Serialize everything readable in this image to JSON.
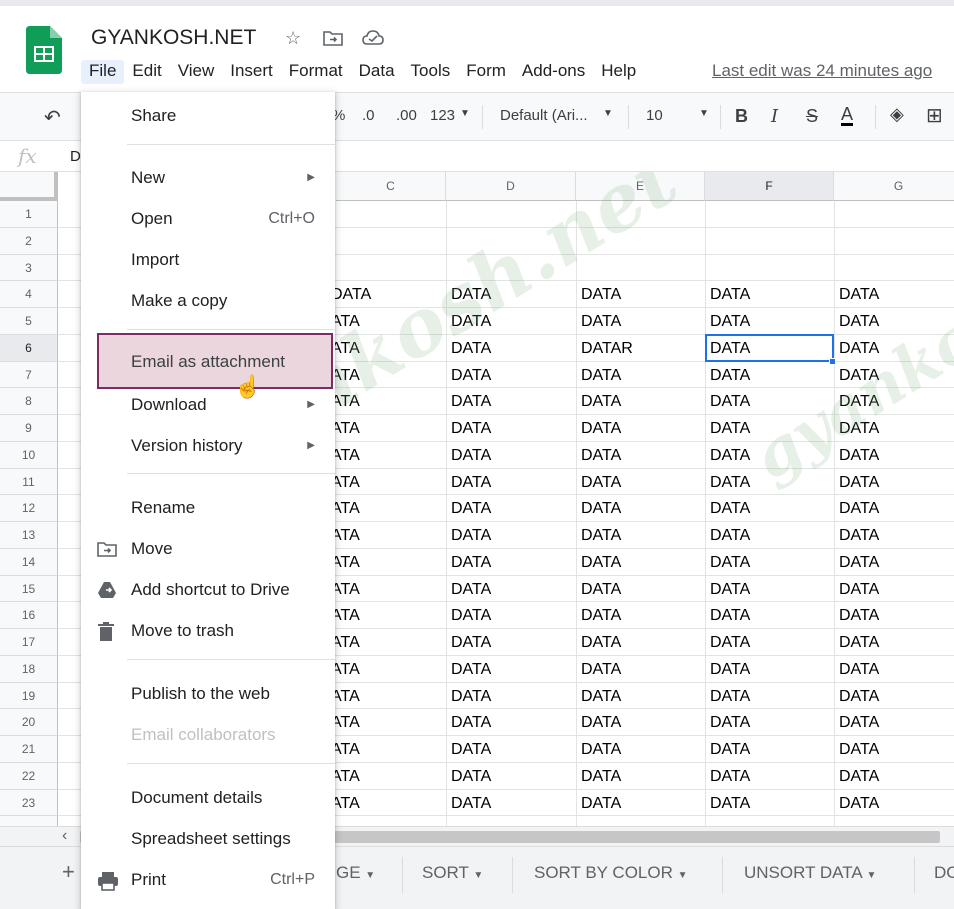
{
  "header": {
    "title": "GYANKOSH.NET",
    "last_edit": "Last edit was 24 minutes ago",
    "menus": [
      "File",
      "Edit",
      "View",
      "Insert",
      "Format",
      "Data",
      "Tools",
      "Form",
      "Add-ons",
      "Help"
    ]
  },
  "toolbar": {
    "percent": "%",
    "dec_less": ".0",
    "dec_more": ".00",
    "format_more": "123",
    "font": "Default (Ari...",
    "font_size": "10",
    "bold": "B",
    "italic": "I",
    "strike": "S",
    "text_color": "A"
  },
  "formula": {
    "fx": "fx",
    "value": "D"
  },
  "grid": {
    "columns": [
      "C",
      "D",
      "E",
      "F",
      "G"
    ],
    "selected_column": "F",
    "rows": [
      "1",
      "2",
      "3",
      "4",
      "5",
      "6",
      "7",
      "8",
      "9",
      "10",
      "11",
      "12",
      "13",
      "14",
      "15",
      "16",
      "17",
      "18",
      "19",
      "20",
      "21",
      "22",
      "23"
    ],
    "selected_row": "6",
    "cells": {
      "C": [
        "",
        "",
        "",
        "DATA",
        "ATA",
        "ATA",
        "ATA",
        "ATA",
        "ATA",
        "ATA",
        "ATA",
        "ATA",
        "ATA",
        "ATA",
        "ATA",
        "ATA",
        "ATA",
        "ATA",
        "ATA",
        "ATA",
        "ATA",
        "ATA",
        "ATA"
      ],
      "D": [
        "",
        "",
        "",
        "DATA",
        "DATA",
        "DATA",
        "DATA",
        "DATA",
        "DATA",
        "DATA",
        "DATA",
        "DATA",
        "DATA",
        "DATA",
        "DATA",
        "DATA",
        "DATA",
        "DATA",
        "DATA",
        "DATA",
        "DATA",
        "DATA",
        "DATA"
      ],
      "E": [
        "",
        "",
        "",
        "DATA",
        "DATA",
        "DATAR",
        "DATA",
        "DATA",
        "DATA",
        "DATA",
        "DATA",
        "DATA",
        "DATA",
        "DATA",
        "DATA",
        "DATA",
        "DATA",
        "DATA",
        "DATA",
        "DATA",
        "DATA",
        "DATA",
        "DATA"
      ],
      "F": [
        "",
        "",
        "",
        "DATA",
        "DATA",
        "DATA",
        "DATA",
        "DATA",
        "DATA",
        "DATA",
        "DATA",
        "DATA",
        "DATA",
        "DATA",
        "DATA",
        "DATA",
        "DATA",
        "DATA",
        "DATA",
        "DATA",
        "DATA",
        "DATA",
        "DATA"
      ],
      "G": [
        "",
        "",
        "",
        "DATA",
        "DATA",
        "DATA",
        "DATA",
        "DATA",
        "DATA",
        "DATA",
        "DATA",
        "DATA",
        "DATA",
        "DATA",
        "DATA",
        "DATA",
        "DATA",
        "DATA",
        "DATA",
        "DATA",
        "DATA",
        "DATA",
        "DATA"
      ]
    },
    "watermark": "gyankosh.net"
  },
  "sheets": [
    "GE",
    "SORT",
    "SORT BY COLOR",
    "UNSORT DATA",
    "DO"
  ],
  "file_menu": {
    "items": [
      {
        "label": "Share",
        "shortcut": "",
        "submenu": false,
        "disabled": false,
        "icon": "",
        "highlight": false
      },
      {
        "sep": true
      },
      {
        "label": "New",
        "shortcut": "",
        "submenu": true,
        "disabled": false,
        "icon": "",
        "highlight": false
      },
      {
        "label": "Open",
        "shortcut": "Ctrl+O",
        "submenu": false,
        "disabled": false,
        "icon": "",
        "highlight": false
      },
      {
        "label": "Import",
        "shortcut": "",
        "submenu": false,
        "disabled": false,
        "icon": "",
        "highlight": false
      },
      {
        "label": "Make a copy",
        "shortcut": "",
        "submenu": false,
        "disabled": false,
        "icon": "",
        "highlight": false
      },
      {
        "sep": true
      },
      {
        "label": "Email as attachment",
        "shortcut": "",
        "submenu": false,
        "disabled": false,
        "icon": "",
        "highlight": true
      },
      {
        "label": "Download",
        "shortcut": "",
        "submenu": true,
        "disabled": false,
        "icon": "",
        "highlight": false
      },
      {
        "label": "Version history",
        "shortcut": "",
        "submenu": true,
        "disabled": false,
        "icon": "",
        "highlight": false
      },
      {
        "sep": true
      },
      {
        "label": "Rename",
        "shortcut": "",
        "submenu": false,
        "disabled": false,
        "icon": "",
        "highlight": false
      },
      {
        "label": "Move",
        "shortcut": "",
        "submenu": false,
        "disabled": false,
        "icon": "move-folder-icon",
        "highlight": false
      },
      {
        "label": "Add shortcut to Drive",
        "shortcut": "",
        "submenu": false,
        "disabled": false,
        "icon": "drive-shortcut-icon",
        "highlight": false
      },
      {
        "label": "Move to trash",
        "shortcut": "",
        "submenu": false,
        "disabled": false,
        "icon": "trash-icon",
        "highlight": false
      },
      {
        "sep": true
      },
      {
        "label": "Publish to the web",
        "shortcut": "",
        "submenu": false,
        "disabled": false,
        "icon": "",
        "highlight": false
      },
      {
        "label": "Email collaborators",
        "shortcut": "",
        "submenu": false,
        "disabled": true,
        "icon": "",
        "highlight": false
      },
      {
        "sep": true
      },
      {
        "label": "Document details",
        "shortcut": "",
        "submenu": false,
        "disabled": false,
        "icon": "",
        "highlight": false
      },
      {
        "label": "Spreadsheet settings",
        "shortcut": "",
        "submenu": false,
        "disabled": false,
        "icon": "",
        "highlight": false
      },
      {
        "label": "Print",
        "shortcut": "Ctrl+P",
        "submenu": false,
        "disabled": false,
        "icon": "print-icon",
        "highlight": false
      }
    ]
  },
  "colors": {
    "accent": "#1a73e8",
    "sheets_green": "#0f9d58",
    "highlight_fill": "#ead6dc",
    "highlight_border": "#7b2c67"
  }
}
